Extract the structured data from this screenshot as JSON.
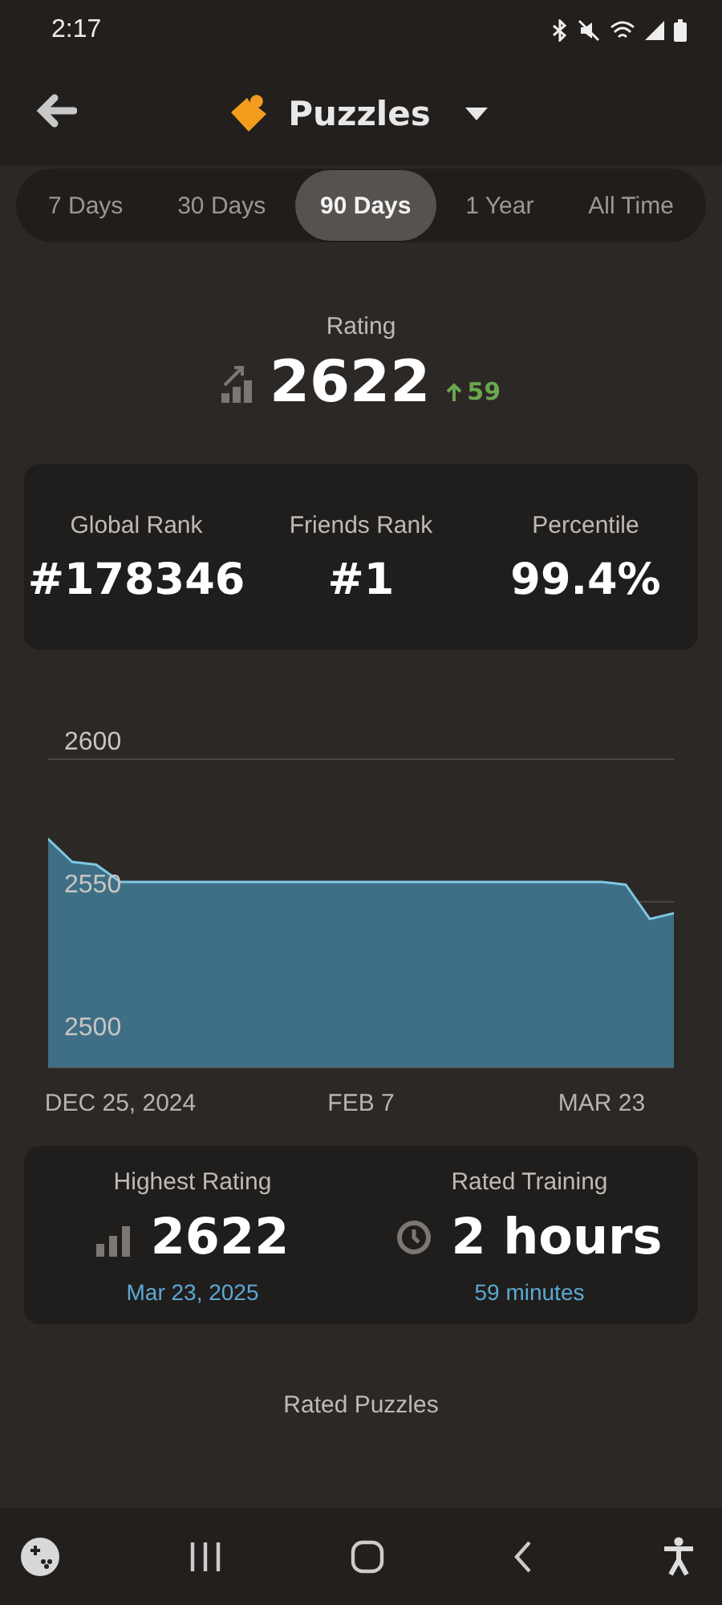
{
  "status_bar": {
    "time": "2:17"
  },
  "header": {
    "title": "Puzzles"
  },
  "tabs": [
    {
      "label": "7 Days",
      "selected": false
    },
    {
      "label": "30 Days",
      "selected": false
    },
    {
      "label": "90 Days",
      "selected": true
    },
    {
      "label": "1 Year",
      "selected": false
    },
    {
      "label": "All Time",
      "selected": false
    }
  ],
  "rating": {
    "label": "Rating",
    "value": "2622",
    "change": "59"
  },
  "ranks": [
    {
      "label": "Global Rank",
      "value": "#178346"
    },
    {
      "label": "Friends Rank",
      "value": "#1"
    },
    {
      "label": "Percentile",
      "value": "99.4%"
    }
  ],
  "chart": {
    "chart_data": {
      "type": "area",
      "categories": [
        null,
        null,
        null,
        "DEC 25, 2024",
        null,
        null,
        null,
        null,
        null,
        null,
        null,
        null,
        null,
        "FEB 7",
        null,
        null,
        null,
        null,
        null,
        null,
        null,
        null,
        null,
        "MAR 23",
        null,
        null,
        null
      ],
      "series": [
        {
          "color": "#3f6f86",
          "values": [
            2572,
            2564,
            2563,
            2557,
            2557,
            2557,
            2557,
            2557,
            2557,
            2557,
            2557,
            2557,
            2557,
            2557,
            2557,
            2557,
            2557,
            2557,
            2557,
            2557,
            2557,
            2557,
            2557,
            2557,
            2556,
            2544,
            2546
          ]
        }
      ],
      "ylim": [
        2492,
        2600
      ],
      "yticks": [
        2500,
        2550,
        2600
      ]
    }
  },
  "highlights": [
    {
      "kind": "bars",
      "label": "Highest Rating",
      "value": "2622",
      "sub": "Mar 23, 2025"
    },
    {
      "kind": "clock",
      "label": "Rated Training",
      "value": "2 hours",
      "sub": "59 minutes"
    }
  ],
  "rated_puzzles": {
    "label": "Rated Puzzles"
  }
}
